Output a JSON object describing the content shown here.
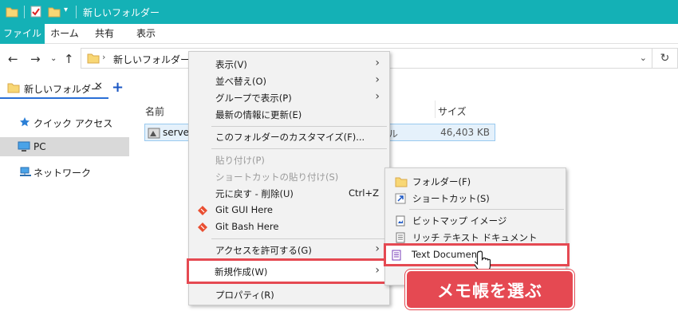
{
  "titlebar": {
    "title": "新しいフォルダー",
    "bg_color": "#14b1b6"
  },
  "ribbon": {
    "tabs": [
      "ファイル",
      "ホーム",
      "共有",
      "表示"
    ]
  },
  "address": {
    "path": "新しいフォルダー"
  },
  "tabs": {
    "current": "新しいフォルダー",
    "close_glyph": "✕",
    "new_glyph": "+"
  },
  "sidebar": {
    "items": [
      {
        "label": "クイック アクセス",
        "icon": "star-icon"
      },
      {
        "label": "PC",
        "icon": "pc-icon"
      },
      {
        "label": "ネットワーク",
        "icon": "network-icon"
      }
    ]
  },
  "filelist": {
    "headers": {
      "name": "名前",
      "size": "サイズ"
    },
    "rows": [
      {
        "name": "server",
        "type": "ル",
        "size": "46,403 KB"
      }
    ]
  },
  "context_menu": {
    "items": [
      {
        "label": "表示(V)",
        "submenu": true
      },
      {
        "label": "並べ替え(O)",
        "submenu": true
      },
      {
        "label": "グループで表示(P)",
        "submenu": true
      },
      {
        "label": "最新の情報に更新(E)"
      },
      {
        "label": "このフォルダーのカスタマイズ(F)..."
      },
      {
        "label": "貼り付け(P)",
        "disabled": true
      },
      {
        "label": "ショートカットの貼り付け(S)",
        "disabled": true
      },
      {
        "label": "元に戻す - 削除(U)",
        "shortcut": "Ctrl+Z"
      },
      {
        "label": "Git GUI Here",
        "icon": "git-icon"
      },
      {
        "label": "Git Bash Here",
        "icon": "git-icon"
      },
      {
        "label": "アクセスを許可する(G)",
        "submenu": true
      },
      {
        "label": "新規作成(W)",
        "submenu": true,
        "highlighted": true
      },
      {
        "label": "プロパティ(R)"
      }
    ]
  },
  "submenu": {
    "items": [
      {
        "label": "フォルダー(F)",
        "icon": "folder-icon"
      },
      {
        "label": "ショートカット(S)",
        "icon": "shortcut-icon"
      },
      {
        "label": "ビットマップ イメージ",
        "icon": "bitmap-icon"
      },
      {
        "label": "リッチ テキスト ドキュメント",
        "icon": "rtf-icon"
      },
      {
        "label": "Text Document",
        "icon": "text-document-icon",
        "highlighted": true
      }
    ]
  },
  "callout": {
    "text": "メモ帳を選ぶ",
    "color": "#e54952"
  }
}
